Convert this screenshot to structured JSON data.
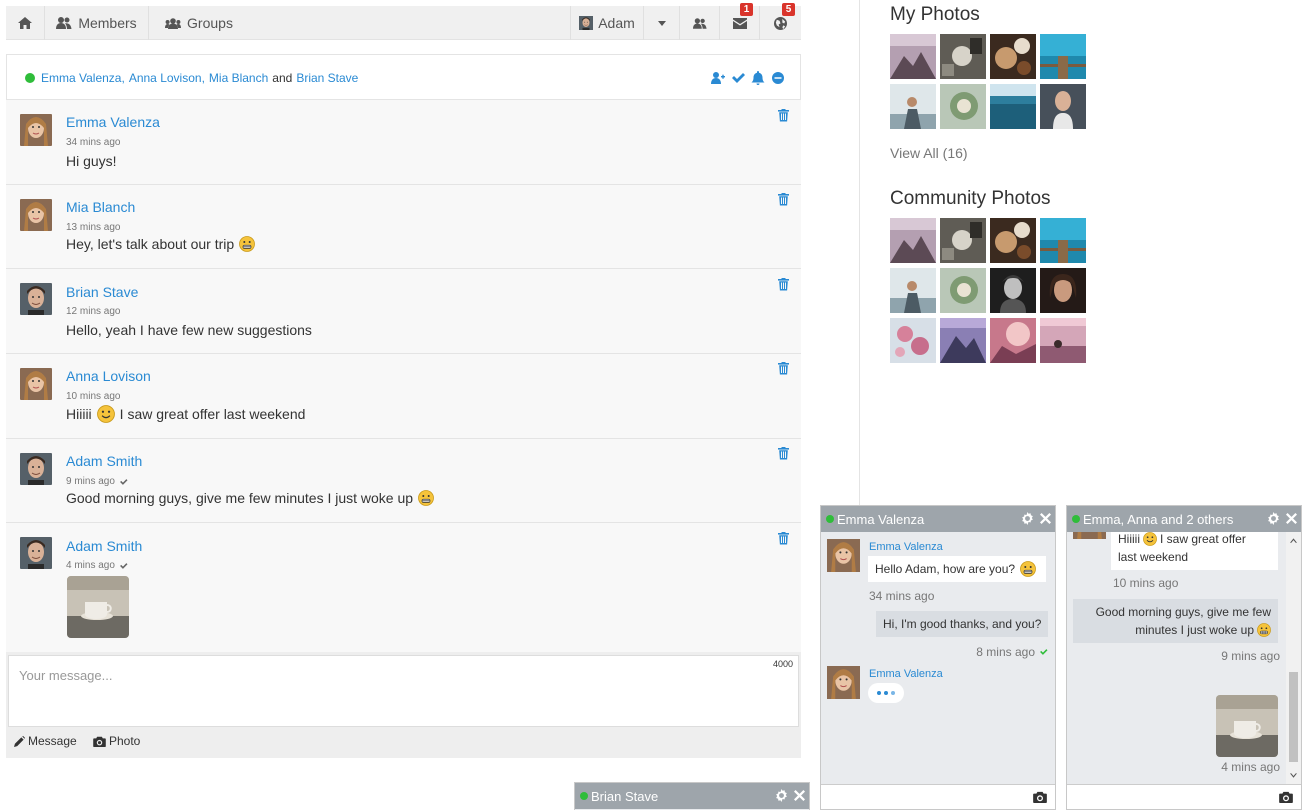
{
  "nav": {
    "members_label": "Members",
    "groups_label": "Groups",
    "user_name": "Adam",
    "messages_badge": "1",
    "notifications_badge": "5"
  },
  "conversation": {
    "participants": [
      "Emma Valenza",
      "Anna Lovison",
      "Mia Blanch",
      "Brian Stave"
    ],
    "sep1": ",",
    "sep2": ",",
    "and_text": "and"
  },
  "messages": [
    {
      "name": "Emma Valenza",
      "time": "34 mins ago",
      "text": "Hi guys!"
    },
    {
      "name": "Mia Blanch",
      "time": "13 mins ago",
      "text": "Hey, let's talk about our trip"
    },
    {
      "name": "Brian Stave",
      "time": "12 mins ago",
      "text": "Hello, yeah I have few new suggestions"
    },
    {
      "name": "Anna Lovison",
      "time": "10 mins ago",
      "text_before": "Hiiiii",
      "text_after": "I saw great offer last weekend"
    },
    {
      "name": "Adam Smith",
      "time": "9 mins ago",
      "text": "Good morning guys, give me few minutes I just woke up"
    },
    {
      "name": "Adam Smith",
      "time": "4 mins ago"
    }
  ],
  "composer": {
    "placeholder": "Your message...",
    "counter": "4000",
    "message_button": "Message",
    "photo_button": "Photo"
  },
  "sidebar": {
    "my_photos_title": "My Photos",
    "view_all": "View All (16)",
    "community_photos_title": "Community Photos"
  },
  "chat_emma": {
    "title": "Emma Valenza",
    "sender": "Emma Valenza",
    "msg1": "Hello Adam, how are you?",
    "time1": "34 mins ago",
    "msg2": "Hi, I'm good thanks, and you?",
    "time2": "8 mins ago",
    "sender2": "Emma Valenza"
  },
  "chat_group": {
    "title": "Emma, Anna and 2 others",
    "msg1_before": "Hiiiii",
    "msg1_line1_after": "I saw great offer",
    "msg1_line2": "last weekend",
    "time1": "10 mins ago",
    "msg2_line1": "Good morning guys, give me few",
    "msg2_line2": "minutes I just woke up",
    "time2": "9 mins ago",
    "time3": "4 mins ago"
  },
  "chat_brian": {
    "title": "Brian Stave"
  },
  "colors": {
    "accent": "#2a8ad3",
    "online": "#2fbd3a",
    "badge": "#d9342b",
    "chat_header": "#9ea5ab"
  },
  "icons": [
    "home-icon",
    "members-icon",
    "groups-icon",
    "caret-down-icon",
    "friends-icon",
    "envelope-icon",
    "globe-icon",
    "add-user-icon",
    "check-icon",
    "bell-icon",
    "minus-circle-icon",
    "trash-icon",
    "pencil-icon",
    "camera-icon",
    "gear-icon",
    "close-icon",
    "chevron-up-icon",
    "chevron-down-icon",
    "emoji-grimace-icon",
    "emoji-smile-icon"
  ]
}
